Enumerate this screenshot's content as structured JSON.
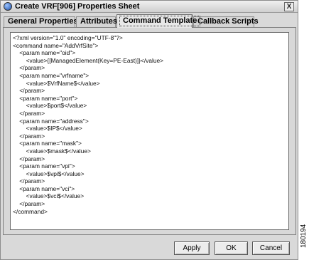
{
  "window": {
    "title": "Create VRF[906] Properties Sheet",
    "close_label": "X"
  },
  "tabs": [
    {
      "label": "General Properties",
      "active": false
    },
    {
      "label": "Attributes",
      "active": false
    },
    {
      "label": "Command Template",
      "active": true
    },
    {
      "label": "Callback Scripts",
      "active": false
    }
  ],
  "editor": {
    "lines": [
      "<?xml version=\"1.0\" encoding=\"UTF-8\"?>",
      "<command name=\"AddVrfSite\">",
      "    <param name=\"oid\">",
      "        <value>{[ManagedElement(Key=PE-East)]}</value>",
      "    </param>",
      "    <param name=\"vrfname\">",
      "        <value>$VrfName$</value>",
      "    </param>",
      "    <param name=\"port\">",
      "        <value>$port$</value>",
      "    </param>",
      "    <param name=\"address\">",
      "        <value>$IP$</value>",
      "    </param>",
      "    <param name=\"mask\">",
      "        <value>$mask$</value>",
      "    </param>",
      "    <param name=\"vpi\">",
      "        <value>$vpi$</value>",
      "    </param>",
      "    <param name=\"vci\">",
      "        <value>$vci$</value>",
      "    </param>",
      "</command>"
    ]
  },
  "buttons": {
    "apply": "Apply",
    "ok": "OK",
    "cancel": "Cancel"
  },
  "figure_id": "180194"
}
